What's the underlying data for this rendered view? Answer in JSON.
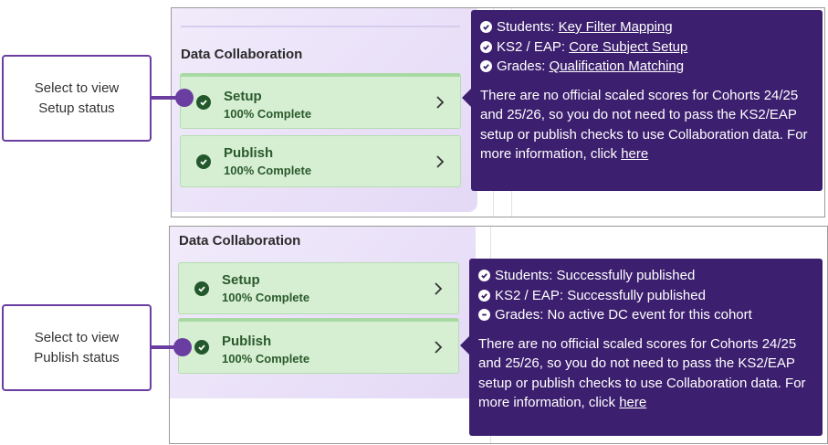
{
  "top": {
    "section_title": "Data Collaboration",
    "cards": [
      {
        "title": "Setup",
        "status": "100% Complete"
      },
      {
        "title": "Publish",
        "status": "100% Complete"
      }
    ],
    "callout": {
      "line1": "Select to view",
      "line2": "Setup status"
    },
    "tooltip": {
      "rows": [
        {
          "label": "Students:",
          "link": "Key Filter Mapping"
        },
        {
          "label": "KS2 / EAP:",
          "link": "Core Subject Setup"
        },
        {
          "label": "Grades:",
          "link": "Qualification Matching"
        }
      ],
      "message": "There are no official scaled scores for Cohorts 24/25 and 25/26, so you do not need to pass the KS2/EAP setup or publish checks to use Collaboration data. For more information, click",
      "link_here": "here"
    }
  },
  "bottom": {
    "section_title": "Data Collaboration",
    "cards": [
      {
        "title": "Setup",
        "status": "100% Complete"
      },
      {
        "title": "Publish",
        "status": "100% Complete"
      }
    ],
    "callout": {
      "line1": "Select to view",
      "line2": "Publish status"
    },
    "tooltip": {
      "rows": [
        {
          "text": "Students: Successfully published",
          "icon": "check-circle-icon"
        },
        {
          "text": "KS2 / EAP: Successfully published",
          "icon": "check-circle-icon"
        },
        {
          "text": "Grades: No active DC event for this cohort",
          "icon": "minus-circle-icon"
        }
      ],
      "message": "There are no official scaled scores for Cohorts 24/25 and 25/26, so you do not need to pass the KS2/EAP setup or publish checks to use Collaboration data. For more information, click",
      "link_here": "here"
    }
  },
  "colors": {
    "accent_purple": "#6a3ea1",
    "tooltip_bg": "#3c1f6e",
    "card_bg": "#d6efd3",
    "check_green": "#23582c"
  }
}
